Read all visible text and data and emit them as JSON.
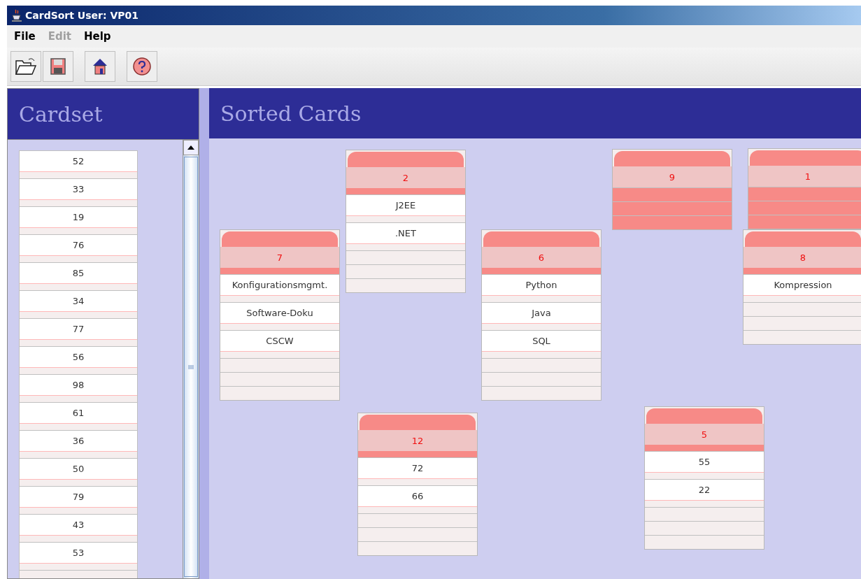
{
  "window": {
    "title": "CardSort User: VP01"
  },
  "menu": [
    {
      "label": "File",
      "disabled": false
    },
    {
      "label": "Edit",
      "disabled": true
    },
    {
      "label": "Help",
      "disabled": false
    }
  ],
  "cardset": {
    "title": "Cardset",
    "cards": [
      "52",
      "33",
      "19",
      "76",
      "85",
      "34",
      "77",
      "56",
      "98",
      "61",
      "36",
      "50",
      "79",
      "43",
      "53"
    ]
  },
  "sorted": {
    "title": "Sorted Cards",
    "groups": [
      {
        "label": "2",
        "collapsed": false,
        "cards": [
          "J2EE",
          ".NET"
        ]
      },
      {
        "label": "9",
        "collapsed": true
      },
      {
        "label": "1",
        "collapsed": true
      },
      {
        "label": "7",
        "collapsed": false,
        "cards": [
          "Konfigurationsmgmt.",
          "Software-Doku",
          "CSCW"
        ]
      },
      {
        "label": "6",
        "collapsed": false,
        "cards": [
          "Python",
          "Java",
          "SQL"
        ]
      },
      {
        "label": "8",
        "collapsed": false,
        "cards": [
          "Kompression"
        ]
      },
      {
        "label": "12",
        "collapsed": false,
        "cards": [
          "72",
          "66"
        ]
      },
      {
        "label": "5",
        "collapsed": false,
        "cards": [
          "55",
          "22"
        ]
      }
    ]
  }
}
